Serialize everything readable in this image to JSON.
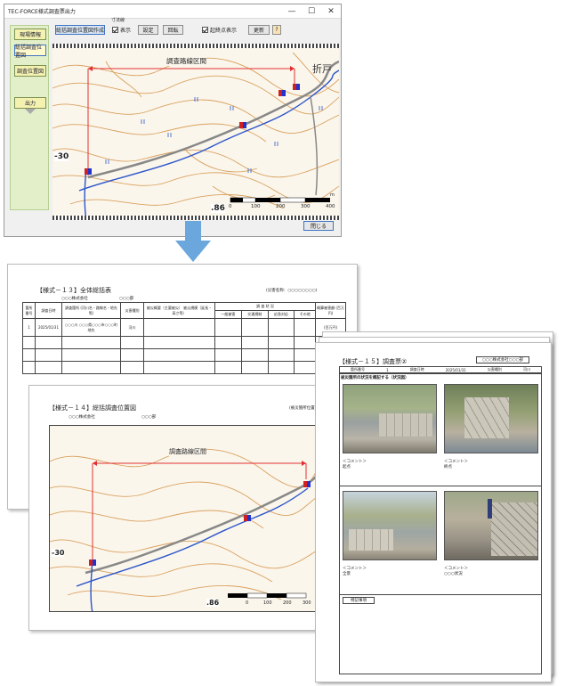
{
  "window": {
    "title": "TEC-FORCE様式調査票出力",
    "minimize": "—",
    "maximize": "☐",
    "close": "✕"
  },
  "sidebar": {
    "items": [
      {
        "label": "現場情報"
      },
      {
        "label": "総括調査位置図"
      },
      {
        "label": "調査位置図"
      },
      {
        "label": "出力"
      }
    ]
  },
  "toolbar": {
    "create_map": "総括調査位置図作成",
    "dimension_group": "寸法線",
    "show_label": "表示",
    "settings_label": "設定",
    "rotate_label": "回転",
    "start_end_label": "起終点表示",
    "update_label": "更新",
    "help_label": "?"
  },
  "map": {
    "survey_label": "調査路線区間",
    "num_left": "-30",
    "num_bottom": ".86",
    "scale_ticks": [
      "0",
      "100",
      "200",
      "300",
      "400"
    ],
    "scale_unit": "m",
    "place": "折戸"
  },
  "footer": {
    "close_label": "閉じる"
  },
  "doc1": {
    "title": "【様式－１３】全体総括表",
    "right_head": "(災害名称：○○○○○○○○)",
    "org": "○○○株式会社",
    "dept": "○○○部",
    "headers": [
      "箇所番号",
      "調査日時",
      "調査箇所\n(河川名・路線名・地先等)",
      "災害種別",
      "被災概要（主要被災）\n被災規模（延長・高さ等）",
      "調 査 状 況",
      "概算被害額\n(百万円)"
    ],
    "subheaders": [
      "一般被害",
      "交通規制",
      "応急対応",
      "その他"
    ],
    "row": [
      "1",
      "2025/01/31",
      "○○○川 ○○○県○○○市○○○町地先",
      "河川",
      "",
      "",
      "",
      "",
      "",
      "(百万円)"
    ]
  },
  "doc2": {
    "title": "【様式－１４】総括調査位置図",
    "right_head": "(被災箇所位置図)",
    "org": "○○○株式会社",
    "dept": "○○○部",
    "survey_label": "調査路線区間",
    "num_left": "-30",
    "num_bottom": ".86",
    "scale_ticks": [
      "0",
      "100",
      "200",
      "300"
    ]
  },
  "doc3": {
    "title": "【様式－１５】調査票②",
    "org": "○○○株式会社○○○部",
    "labels": [
      "箇所番号",
      "1",
      "調査日時",
      "2025/01/31",
      "災害種別",
      "河川"
    ],
    "section": "被災箇所の状況を概記する（状況図）",
    "comments": [
      "＜コメント＞\n起点",
      "＜コメント＞\n終点",
      "＜コメント＞\n全景",
      "＜コメント＞\n○○○状況"
    ],
    "special": "特記事項"
  }
}
